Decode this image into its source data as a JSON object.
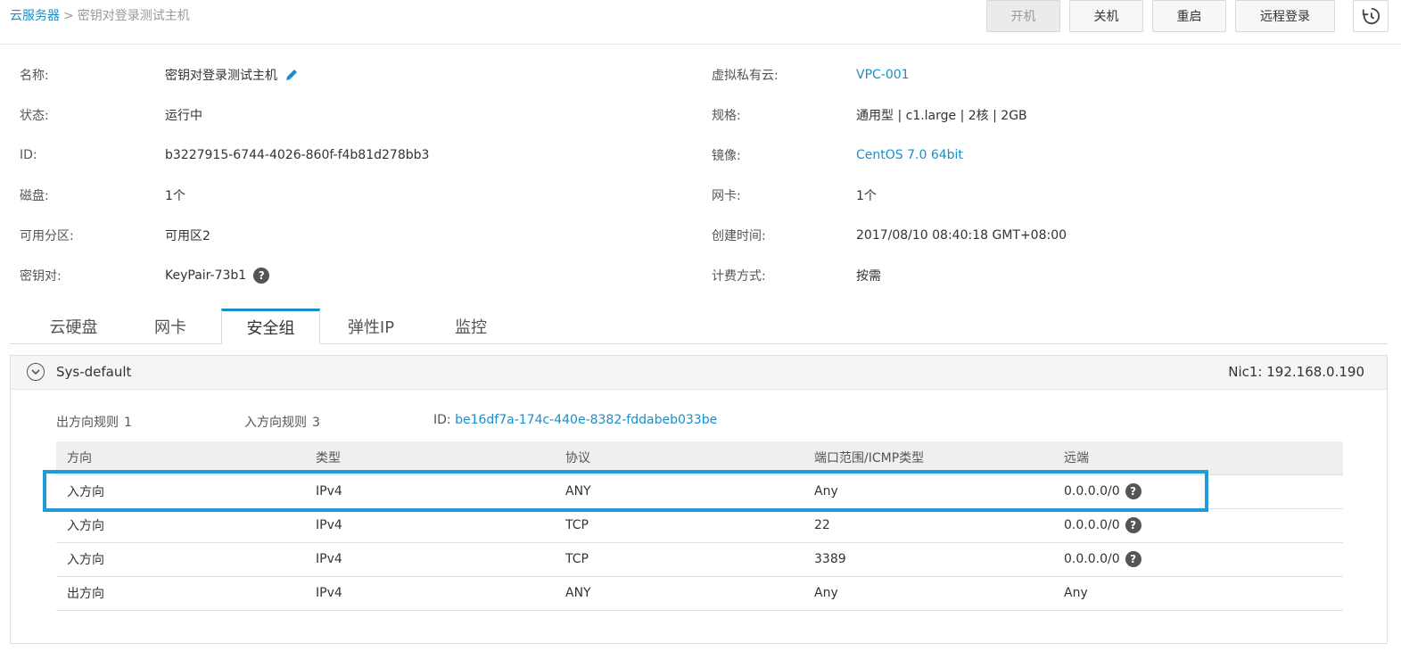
{
  "breadcrumb": {
    "parent": "云服务器",
    "separator": ">",
    "current": "密钥对登录测试主机"
  },
  "actions": {
    "start": "开机",
    "stop": "关机",
    "restart": "重启",
    "remote_login": "远程登录"
  },
  "info": {
    "left": [
      {
        "label": "名称:",
        "value": "密钥对登录测试主机"
      },
      {
        "label": "状态:",
        "value": "运行中"
      },
      {
        "label": "ID:",
        "value": "b3227915-6744-4026-860f-f4b81d278bb3"
      },
      {
        "label": "磁盘:",
        "value": "1个"
      },
      {
        "label": "可用分区:",
        "value": "可用区2"
      },
      {
        "label": "密钥对:",
        "value": "KeyPair-73b1"
      }
    ],
    "right": [
      {
        "label": "虚拟私有云:",
        "value": "VPC-001"
      },
      {
        "label": "规格:",
        "value": "通用型 | c1.large | 2核 | 2GB"
      },
      {
        "label": "镜像:",
        "value": "CentOS 7.0 64bit"
      },
      {
        "label": "网卡:",
        "value": "1个"
      },
      {
        "label": "创建时间:",
        "value": "2017/08/10 08:40:18 GMT+08:00"
      },
      {
        "label": "计费方式:",
        "value": "按需"
      }
    ]
  },
  "tabs": [
    "云硬盘",
    "网卡",
    "安全组",
    "弹性IP",
    "监控"
  ],
  "active_tab": "安全组",
  "security_group": {
    "name": "Sys-default",
    "nic": "Nic1: 192.168.0.190",
    "outbound_label": "出方向规则",
    "outbound_count": "1",
    "inbound_label": "入方向规则",
    "inbound_count": "3",
    "id_label": "ID:",
    "id_value": "be16df7a-174c-440e-8382-fddabeb033be",
    "columns": [
      "方向",
      "类型",
      "协议",
      "端口范围/ICMP类型",
      "远端"
    ],
    "rows": [
      [
        "入方向",
        "IPv4",
        "ANY",
        "Any",
        "0.0.0.0/0"
      ],
      [
        "入方向",
        "IPv4",
        "TCP",
        "22",
        "0.0.0.0/0"
      ],
      [
        "入方向",
        "IPv4",
        "TCP",
        "3389",
        "0.0.0.0/0"
      ],
      [
        "出方向",
        "IPv4",
        "ANY",
        "Any",
        "Any"
      ]
    ]
  },
  "colors": {
    "link": "#1a8ec7",
    "highlight": "#1f9bd6",
    "tab_active": "#1a8ec7"
  }
}
